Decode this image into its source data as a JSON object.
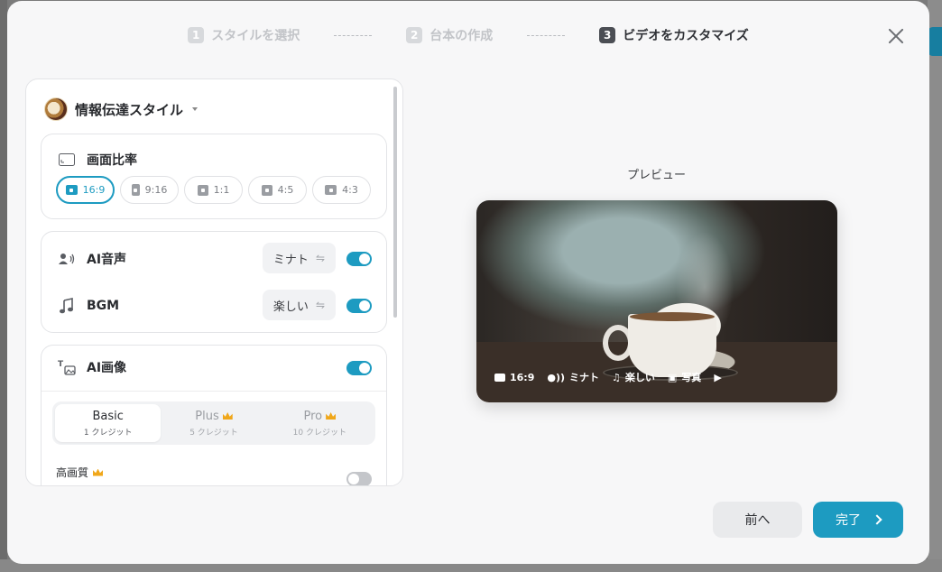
{
  "stepper": {
    "steps": [
      {
        "num": "1",
        "label": "スタイルを選択"
      },
      {
        "num": "2",
        "label": "台本の作成"
      },
      {
        "num": "3",
        "label": "ビデオをカスタマイズ"
      }
    ]
  },
  "style": {
    "name": "情報伝達スタイル"
  },
  "ratio": {
    "label": "画面比率",
    "options": [
      "16:9",
      "9:16",
      "1:1",
      "4:5",
      "4:3"
    ],
    "selected": "16:9"
  },
  "voice": {
    "label": "AI音声",
    "value": "ミナト",
    "enabled": true
  },
  "bgm": {
    "label": "BGM",
    "value": "楽しい",
    "enabled": true
  },
  "ai_image": {
    "label": "AI画像",
    "enabled": true,
    "tiers": [
      {
        "name": "Basic",
        "credits": "1 クレジット"
      },
      {
        "name": "Plus",
        "credits": "5 クレジット"
      },
      {
        "name": "Pro",
        "credits": "10 クレジット"
      }
    ],
    "selected_tier": "Basic",
    "hq_label": "高画質",
    "hq_enabled": false
  },
  "preview": {
    "label": "プレビュー",
    "ratio": "16:9",
    "voice": "ミナト",
    "bgm": "楽しい",
    "media": "写真"
  },
  "footer": {
    "prev_label": "前へ",
    "done_label": "完了"
  },
  "colors": {
    "accent": "#1d9bc1"
  }
}
